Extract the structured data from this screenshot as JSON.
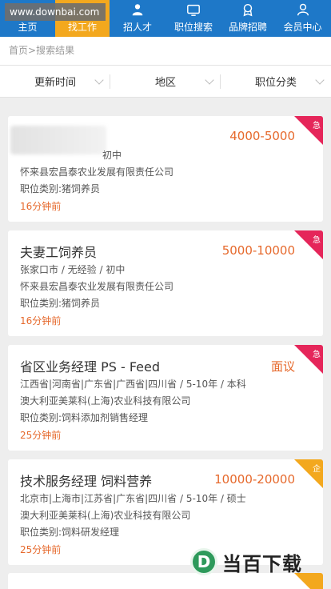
{
  "watermark": "www.downbai.com",
  "nav": {
    "home": "主页",
    "jobs": "找工作",
    "recruit": "招人才",
    "search": "职位搜索",
    "brand": "品牌招聘",
    "member": "会员中心"
  },
  "breadcrumb": {
    "home": "首页",
    "sep": ">",
    "current": "搜索结果"
  },
  "filters": {
    "time": "更新时间",
    "area": "地区",
    "category": "职位分类"
  },
  "jobs": [
    {
      "title": "",
      "salary": "4000-5000",
      "meta": "初中",
      "company": "怀来县宏昌泰农业发展有限责任公司",
      "category": "职位类别:猪饲养员",
      "time": "16分钟前",
      "badge": "急",
      "badge_color": "#e5265a"
    },
    {
      "title": "夫妻工饲养员",
      "salary": "5000-10000",
      "meta": "张家口市 / 无经验 / 初中",
      "company": "怀来县宏昌泰农业发展有限责任公司",
      "category": "职位类别:猪饲养员",
      "time": "16分钟前",
      "badge": "急",
      "badge_color": "#e5265a"
    },
    {
      "title": "省区业务经理 PS - Feed",
      "salary": "面议",
      "meta": "江西省|河南省|广东省|广西省|四川省 / 5-10年 / 本科",
      "company": "澳大利亚美莱科(上海)农业科技有限公司",
      "category": "职位类别:饲料添加剂销售经理",
      "time": "25分钟前",
      "badge": "急",
      "badge_color": "#e5265a"
    },
    {
      "title": "技术服务经理 饲料营养",
      "salary": "10000-20000",
      "meta": "北京市|上海市|江苏省|广东省|四川省 / 5-10年 / 硕士",
      "company": "澳大利亚美莱科(上海)农业科技有限公司",
      "category": "职位类别:饲料研发经理",
      "time": "25分钟前",
      "badge": "企",
      "badge_color": "#f3a81e"
    }
  ],
  "logo": {
    "letter": "D",
    "text": "当百下载"
  }
}
